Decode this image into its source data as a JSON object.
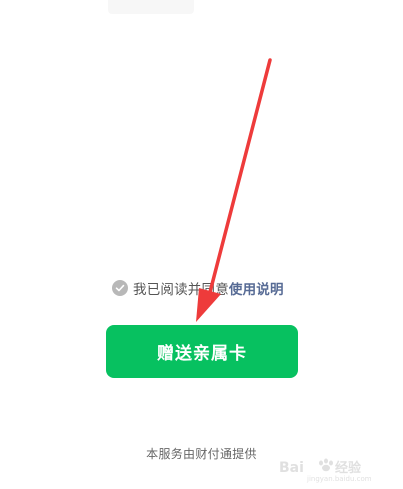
{
  "agreement": {
    "prefix": "我已阅读并同意",
    "link_label": "使用说明"
  },
  "primary_action": {
    "label": "赠送亲属卡"
  },
  "footer": {
    "provider_text": "本服务由财付通提供"
  },
  "watermark": {
    "text": "Baidu 经验",
    "url_text": "jingyan.baidu.com"
  },
  "colors": {
    "accent": "#07c160",
    "link": "#576b95",
    "annotation_arrow": "#ee3b3b"
  }
}
